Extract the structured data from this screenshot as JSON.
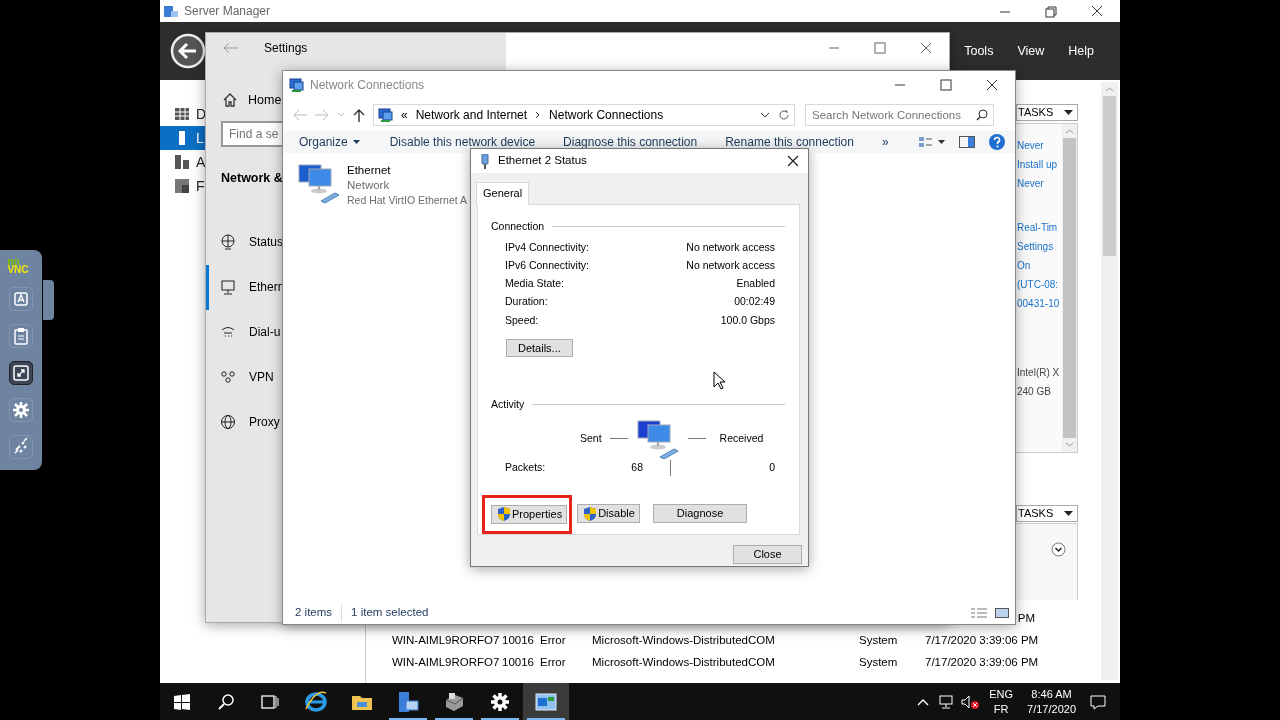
{
  "vnc_panel": {
    "logo": [
      "no",
      "VNC"
    ],
    "buttons": [
      {
        "kind": "keyboard",
        "selected": false
      },
      {
        "kind": "clipboard",
        "selected": false
      },
      {
        "kind": "fullscreen",
        "selected": true
      },
      {
        "kind": "settings",
        "selected": false
      },
      {
        "kind": "disconnect",
        "selected": false
      }
    ]
  },
  "server_manager": {
    "title": "Server Manager",
    "menu": [
      "Tools",
      "View",
      "Help"
    ],
    "nav": [
      {
        "label": "D",
        "kind": "dashboard",
        "selected": false
      },
      {
        "label": "L",
        "kind": "local",
        "selected": true
      },
      {
        "label": "A",
        "kind": "all",
        "selected": false
      },
      {
        "label": "F",
        "kind": "file",
        "selected": false
      }
    ],
    "tasks_buttons": [
      "TASKS",
      "TASKS"
    ],
    "property_groups": [
      [
        "Never",
        "Install up",
        "Never"
      ],
      [
        "Real-Tim",
        "Settings",
        "On",
        "(UTC-08:",
        "00431-10"
      ],
      [
        "Intel(R) X",
        "240 GB"
      ]
    ],
    "events": [
      {
        "kind": "partial",
        "cells": [
          "PM"
        ]
      },
      {
        "kind": "full",
        "cells": [
          "WIN-AIML9RORFO7",
          "10016",
          "Error",
          "Microsoft-Windows-DistributedCOM",
          "System",
          "7/17/2020 3:39:06 PM"
        ]
      },
      {
        "kind": "full",
        "cells": [
          "WIN-AIML9RORFO7",
          "10016",
          "Error",
          "Microsoft-Windows-DistributedCOM",
          "System",
          "7/17/2020 3:39:06 PM"
        ]
      }
    ]
  },
  "settings": {
    "title": "Settings",
    "home": "Home",
    "search_placeholder": "Find a se",
    "heading": "Network &",
    "items": [
      {
        "label": "Status",
        "kind": "status",
        "selected": false
      },
      {
        "label": "Ethern",
        "kind": "ethernet",
        "selected": true
      },
      {
        "label": "Dial-u",
        "kind": "dialup",
        "selected": false
      },
      {
        "label": "VPN",
        "kind": "vpn",
        "selected": false
      },
      {
        "label": "Proxy",
        "kind": "proxy",
        "selected": false
      }
    ]
  },
  "network_connections": {
    "title": "Network Connections",
    "collapsed_marker": "«",
    "breadcrumb": [
      "Network and Internet",
      "Network Connections"
    ],
    "search_placeholder": "Search Network Connections",
    "toolbar": [
      {
        "label": "Organize",
        "kind": "menu"
      },
      {
        "label": "Disable this network device",
        "kind": "command"
      },
      {
        "label": "Diagnose this connection",
        "kind": "command"
      },
      {
        "label": "Rename this connection",
        "kind": "command"
      },
      {
        "label": "»",
        "kind": "overflow"
      }
    ],
    "connections": [
      {
        "name": "Ethernet",
        "status": "Network",
        "device": "Red Hat VirtIO Ethernet A"
      }
    ],
    "status_bar": [
      "2 items",
      "1 item selected"
    ]
  },
  "dialog": {
    "title": "Ethernet 2 Status",
    "tabs": [
      {
        "label": "General",
        "selected": true
      }
    ],
    "connection": {
      "heading": "Connection",
      "rows": [
        {
          "label": "IPv4 Connectivity:",
          "value": "No network access"
        },
        {
          "label": "IPv6 Connectivity:",
          "value": "No network access"
        },
        {
          "label": "Media State:",
          "value": "Enabled"
        },
        {
          "label": "Duration:",
          "value": "00:02:49"
        },
        {
          "label": "Speed:",
          "value": "100.0 Gbps"
        }
      ],
      "details_button": "Details..."
    },
    "activity": {
      "heading": "Activity",
      "sent": "Sent",
      "received": "Received",
      "packets_label": "Packets:",
      "packets_sent": "68",
      "packets_received": "0"
    },
    "actions": [
      {
        "label": "Properties",
        "shield": true,
        "highlighted": true
      },
      {
        "label": "Disable",
        "shield": true,
        "highlighted": false
      },
      {
        "label": "Diagnose",
        "shield": false,
        "highlighted": false
      }
    ],
    "close_button": "Close"
  },
  "taskbar": {
    "apps": [
      {
        "kind": "ie",
        "running": false,
        "selected": false
      },
      {
        "kind": "explorer",
        "running": false,
        "selected": false
      },
      {
        "kind": "servermanager",
        "running": true,
        "selected": false
      },
      {
        "kind": "drive",
        "running": true,
        "selected": false
      },
      {
        "kind": "settings",
        "running": true,
        "selected": false
      },
      {
        "kind": "netconn",
        "running": true,
        "selected": true
      }
    ],
    "tray": {
      "language": "ENG",
      "layout": "FR",
      "time": "8:46 AM",
      "date": "7/17/2020"
    }
  }
}
